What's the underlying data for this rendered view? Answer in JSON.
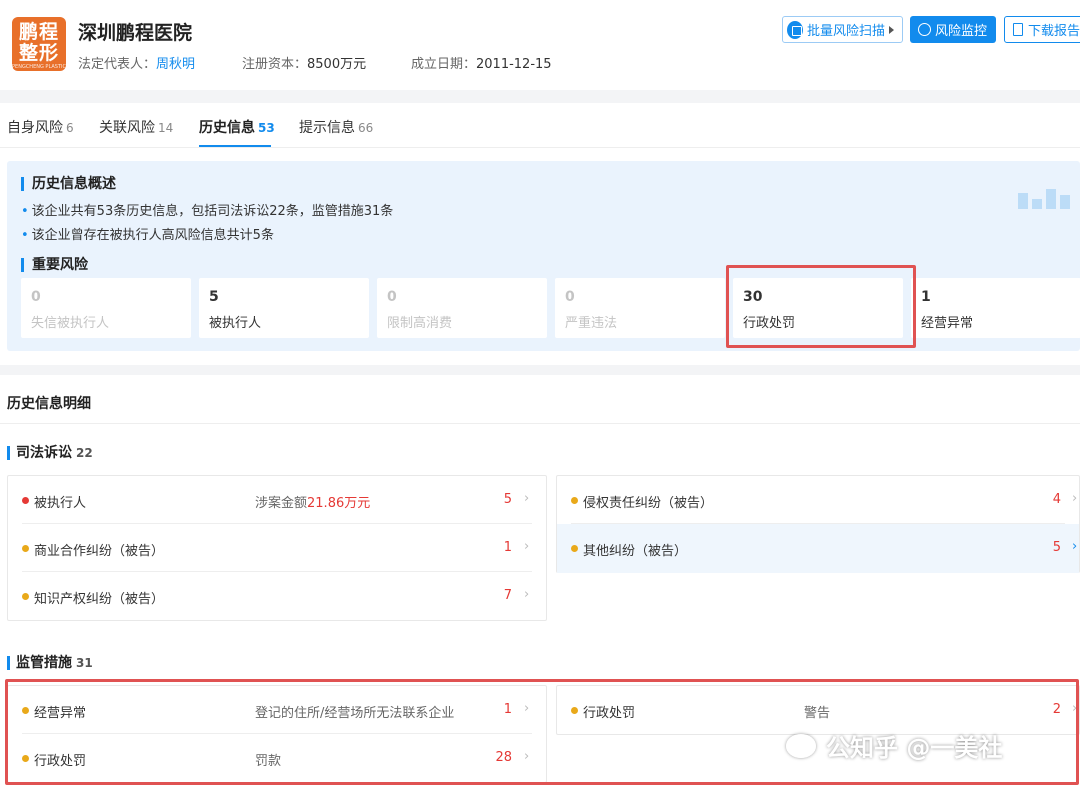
{
  "company": {
    "logo_text_line1": "鹏程",
    "logo_text_line2": "整形",
    "logo_subtext": "PENGCHENG PLASTIC",
    "name": "深圳鹏程医院",
    "legal_rep_label": "法定代表人：",
    "legal_rep": "周秋明",
    "capital_label": "注册资本：",
    "capital": "8500万元",
    "founded_label": "成立日期：",
    "founded": "2011-12-15"
  },
  "actions": {
    "scan": "批量风险扫描",
    "monitor": "风险监控",
    "report": "下载报告"
  },
  "tabs": [
    {
      "label": "自身风险",
      "count": "6"
    },
    {
      "label": "关联风险",
      "count": "14"
    },
    {
      "label": "历史信息",
      "count": "53"
    },
    {
      "label": "提示信息",
      "count": "66"
    }
  ],
  "overview": {
    "title": "历史信息概述",
    "bullets": [
      "该企业共有53条历史信息，包括司法诉讼22条，监管措施31条",
      "该企业曾存在被执行人高风险信息共计5条"
    ],
    "important_title": "重要风险",
    "stats": [
      {
        "value": "0",
        "label": "失信被执行人"
      },
      {
        "value": "5",
        "label": "被执行人"
      },
      {
        "value": "0",
        "label": "限制高消费"
      },
      {
        "value": "0",
        "label": "严重违法"
      },
      {
        "value": "30",
        "label": "行政处罚"
      },
      {
        "value": "1",
        "label": "经营异常"
      }
    ]
  },
  "detail": {
    "title": "历史信息明细",
    "judicial": {
      "title": "司法诉讼",
      "count": "22",
      "left": [
        {
          "name": "被执行人",
          "desc_prefix": "涉案金额",
          "desc_amount": "21.86万元",
          "count": "5"
        },
        {
          "name": "商业合作纠纷（被告）",
          "count": "1"
        },
        {
          "name": "知识产权纠纷（被告）",
          "count": "7"
        }
      ],
      "right": [
        {
          "name": "侵权责任纠纷（被告）",
          "count": "4"
        },
        {
          "name": "其他纠纷（被告）",
          "count": "5"
        }
      ]
    },
    "regulatory": {
      "title": "监管措施",
      "count": "31",
      "left": [
        {
          "name": "经营异常",
          "desc": "登记的住所/经营场所无法联系企业",
          "count": "1"
        },
        {
          "name": "行政处罚",
          "desc": "罚款",
          "count": "28"
        }
      ],
      "right": [
        {
          "name": "行政处罚",
          "desc": "警告",
          "count": "2"
        }
      ]
    }
  },
  "watermark": "公知乎 @一美社",
  "chevron": "›",
  "colors": {
    "accent": "#128bed",
    "danger": "#e53935",
    "warning": "#e9a91a",
    "highlight_border": "#e05252"
  }
}
